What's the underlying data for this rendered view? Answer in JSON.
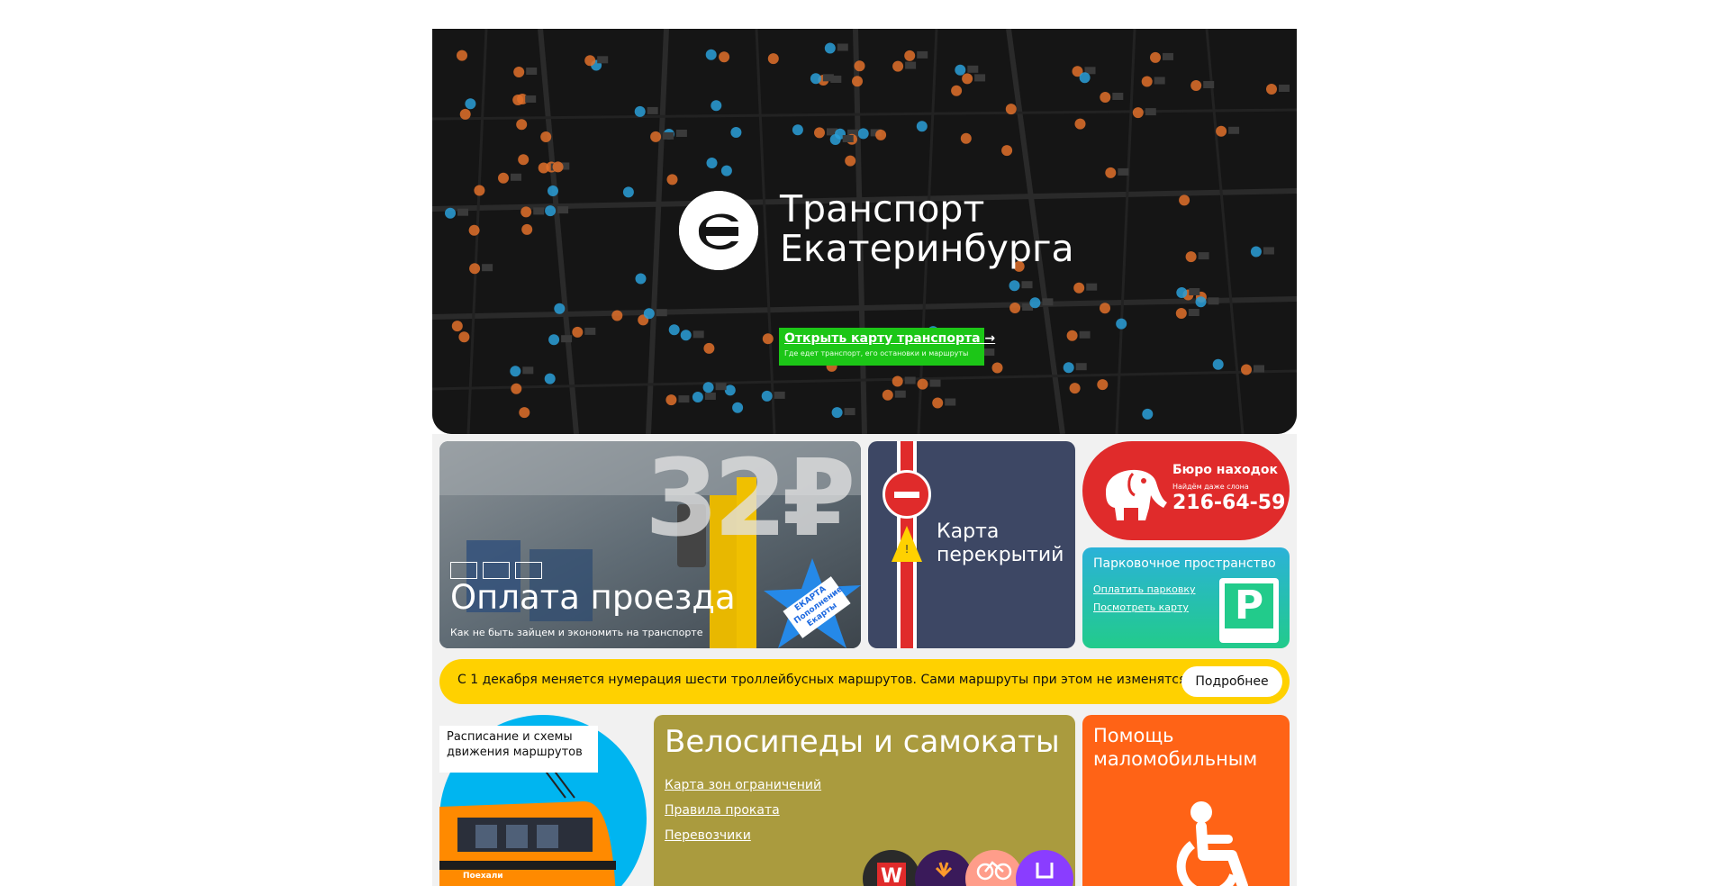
{
  "hero": {
    "title_line1": "Транспорт",
    "title_line2": "Екатеринбурга",
    "cta_link": "Открыть карту транспорта →",
    "cta_sub": "Где едет транспорт, его остановки и маршруты",
    "colors": {
      "map_bg": "#151515",
      "cta": "#1cc617"
    }
  },
  "payment": {
    "price": "32₽",
    "title": "Оплата проезда",
    "subtitle": "Как не быть зайцем и экономить на транспорте",
    "card_label": "ЕКАРТА",
    "star_label": "ЕКАРТА Пополнение Екарты"
  },
  "closures": {
    "title_line1": "Карта",
    "title_line2": "перекрытий"
  },
  "lost_found": {
    "title": "Бюро находок",
    "subtitle": "Найдём даже слона",
    "phone": "216-64-59",
    "color": "#e02b2b"
  },
  "parking": {
    "title": "Парковочное пространство",
    "link_pay": "Оплатить парковку",
    "link_map": "Посмотреть карту",
    "sign": "P"
  },
  "notice": {
    "text": "С 1 декабря меняется нумерация шести троллейбусных маршрутов. Сами маршруты при этом не изменятся",
    "button": "Подробнее",
    "color": "#ffd100"
  },
  "schedule": {
    "title_line1": "Расписание и схемы",
    "title_line2": "движения маршрутов",
    "tram_text": "Поехали"
  },
  "bikes": {
    "title": "Велосипеды и самокаты",
    "links": [
      "Карта зон ограничений",
      "Правила проката",
      "Перевозчики"
    ],
    "operator_w": "W"
  },
  "accessibility": {
    "title_line1": "Помощь",
    "title_line2": "маломобильным"
  }
}
